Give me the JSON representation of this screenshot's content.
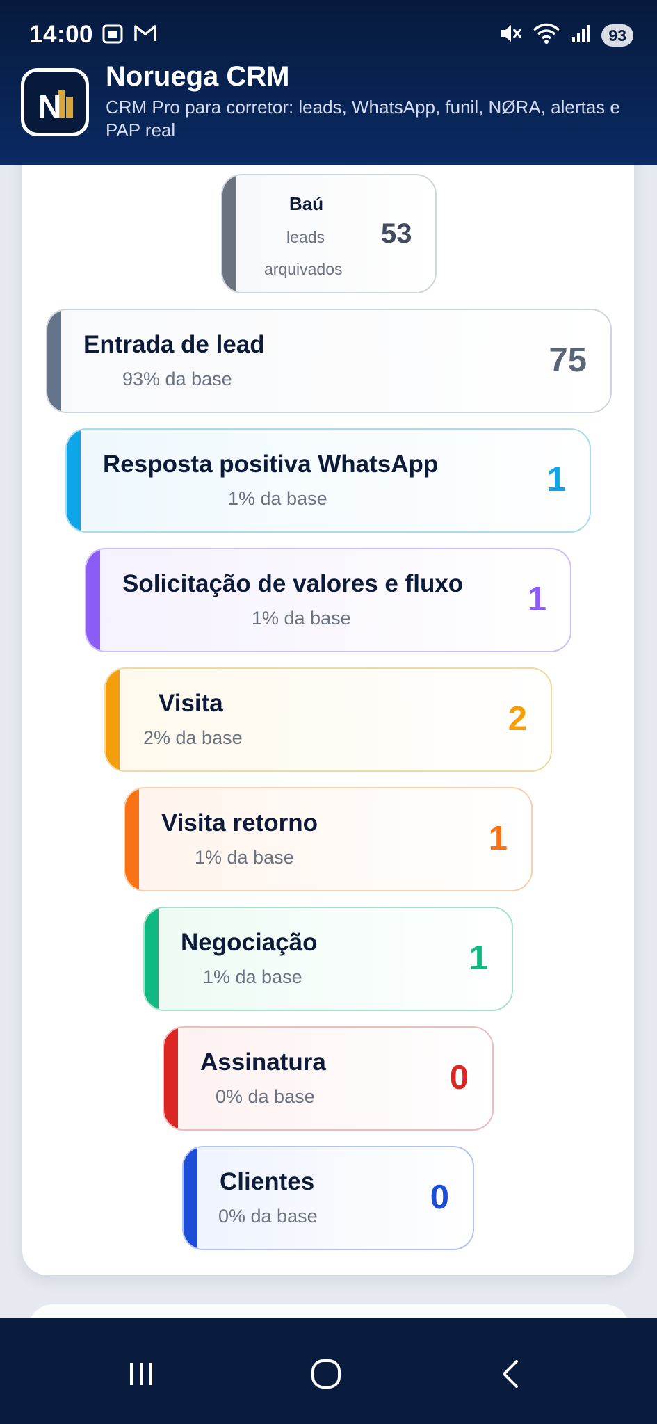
{
  "status_bar": {
    "time": "14:00",
    "battery": "93",
    "icons_left": [
      "screenshot-icon",
      "gmail-icon"
    ],
    "icons_right": [
      "mute-icon",
      "wifi-icon",
      "signal-icon"
    ]
  },
  "app": {
    "title": "Noruega CRM",
    "subtitle": "CRM Pro para corretor: leads, WhatsApp, funil, NØRA, alertas e PAP real",
    "logo_letter": "N"
  },
  "funnel": {
    "archive": {
      "label": "Baú",
      "sub_line1": "leads",
      "sub_line2": "arquivados",
      "count": "53",
      "color": "#6b7280"
    },
    "stages": [
      {
        "label": "Entrada de lead",
        "sub": "93% da base",
        "count": "75",
        "color": "#64748b"
      },
      {
        "label": "Resposta positiva WhatsApp",
        "sub": "1% da base",
        "count": "1",
        "color": "#0ea5e9"
      },
      {
        "label": "Solicitação de valores e fluxo",
        "sub": "1% da base",
        "count": "1",
        "color": "#8b5cf6"
      },
      {
        "label": "Visita",
        "sub": "2% da base",
        "count": "2",
        "color": "#f59e0b"
      },
      {
        "label": "Visita retorno",
        "sub": "1% da base",
        "count": "1",
        "color": "#f97316"
      },
      {
        "label": "Negociação",
        "sub": "1% da base",
        "count": "1",
        "color": "#10b981"
      },
      {
        "label": "Assinatura",
        "sub": "0% da base",
        "count": "0",
        "color": "#dc2626"
      },
      {
        "label": "Clientes",
        "sub": "0% da base",
        "count": "0",
        "color": "#1d4ed8"
      }
    ]
  },
  "nav": {
    "recent": "recent-apps-icon",
    "home": "home-icon",
    "back": "back-icon"
  }
}
